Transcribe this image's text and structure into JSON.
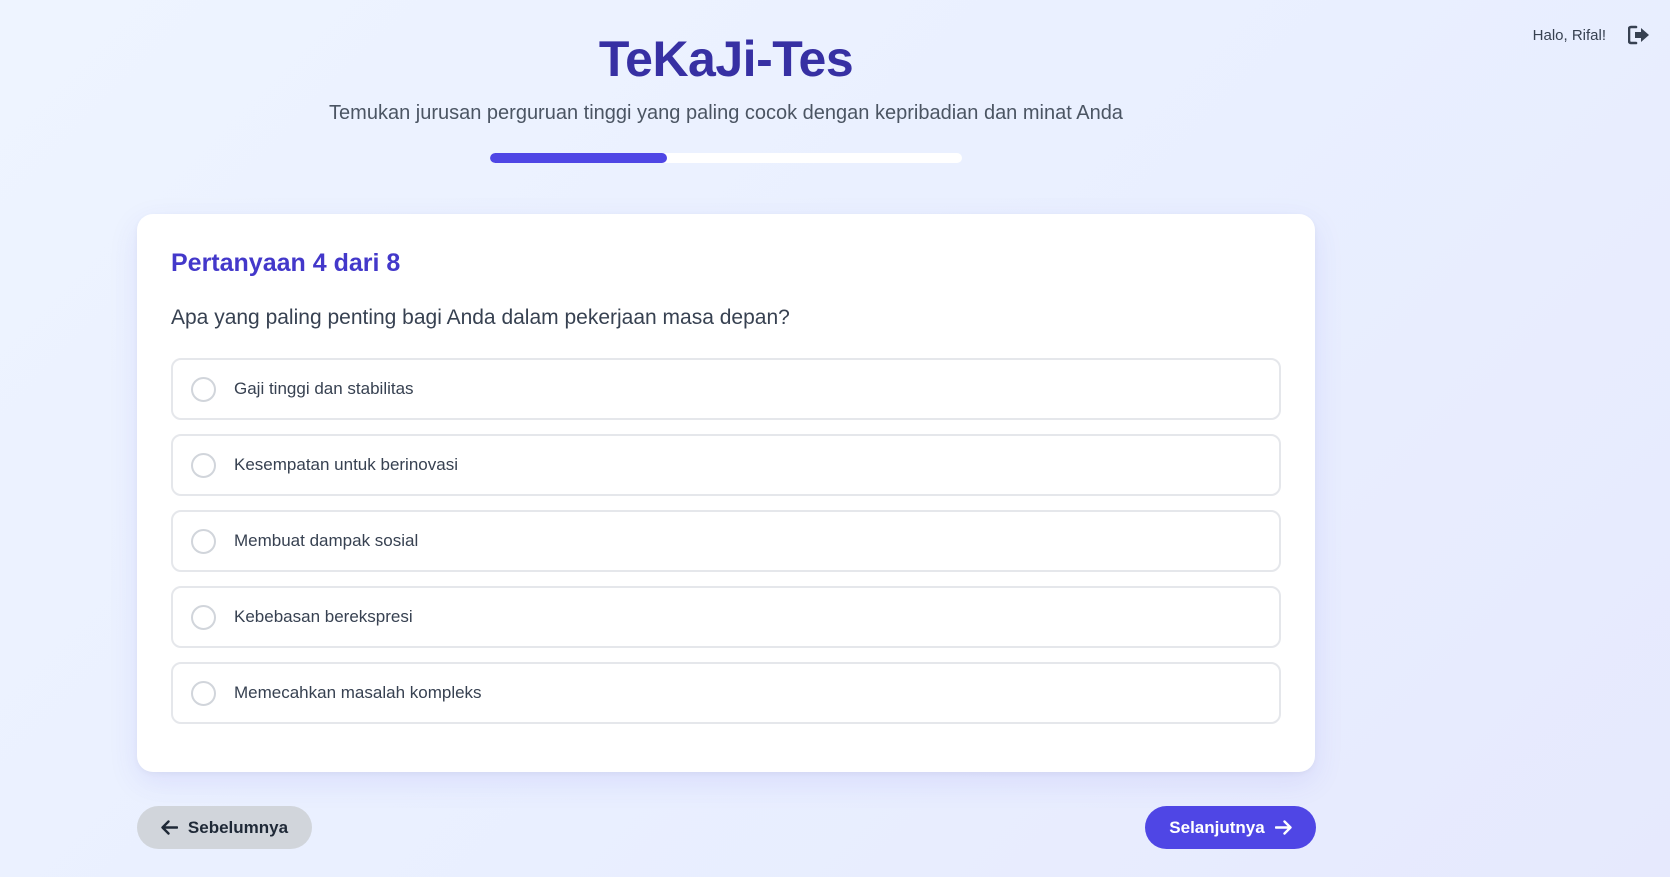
{
  "user": {
    "greeting": "Halo, Rifal!",
    "logout_icon": "logout-icon"
  },
  "header": {
    "title": "TeKaJi-Tes",
    "subtitle": "Temukan jurusan perguruan tinggi yang paling cocok dengan kepribadian dan minat Anda"
  },
  "progress": {
    "fraction": 0.375
  },
  "question": {
    "number_label": "Pertanyaan 4 dari 8",
    "text": "Apa yang paling penting bagi Anda dalam pekerjaan masa depan?",
    "options": [
      {
        "label": "Gaji tinggi dan stabilitas"
      },
      {
        "label": "Kesempatan untuk berinovasi"
      },
      {
        "label": "Membuat dampak sosial"
      },
      {
        "label": "Kebebasan berekspresi"
      },
      {
        "label": "Memecahkan masalah kompleks"
      }
    ]
  },
  "navigation": {
    "prev_label": "Sebelumnya",
    "prev_icon": "arrow-left-icon",
    "next_label": "Selanjutnya",
    "next_icon": "arrow-right-icon"
  },
  "colors": {
    "accent": "#4f46e5",
    "title": "#3730a3",
    "question_number": "#4338ca",
    "prev_button_bg": "#d1d5db"
  }
}
